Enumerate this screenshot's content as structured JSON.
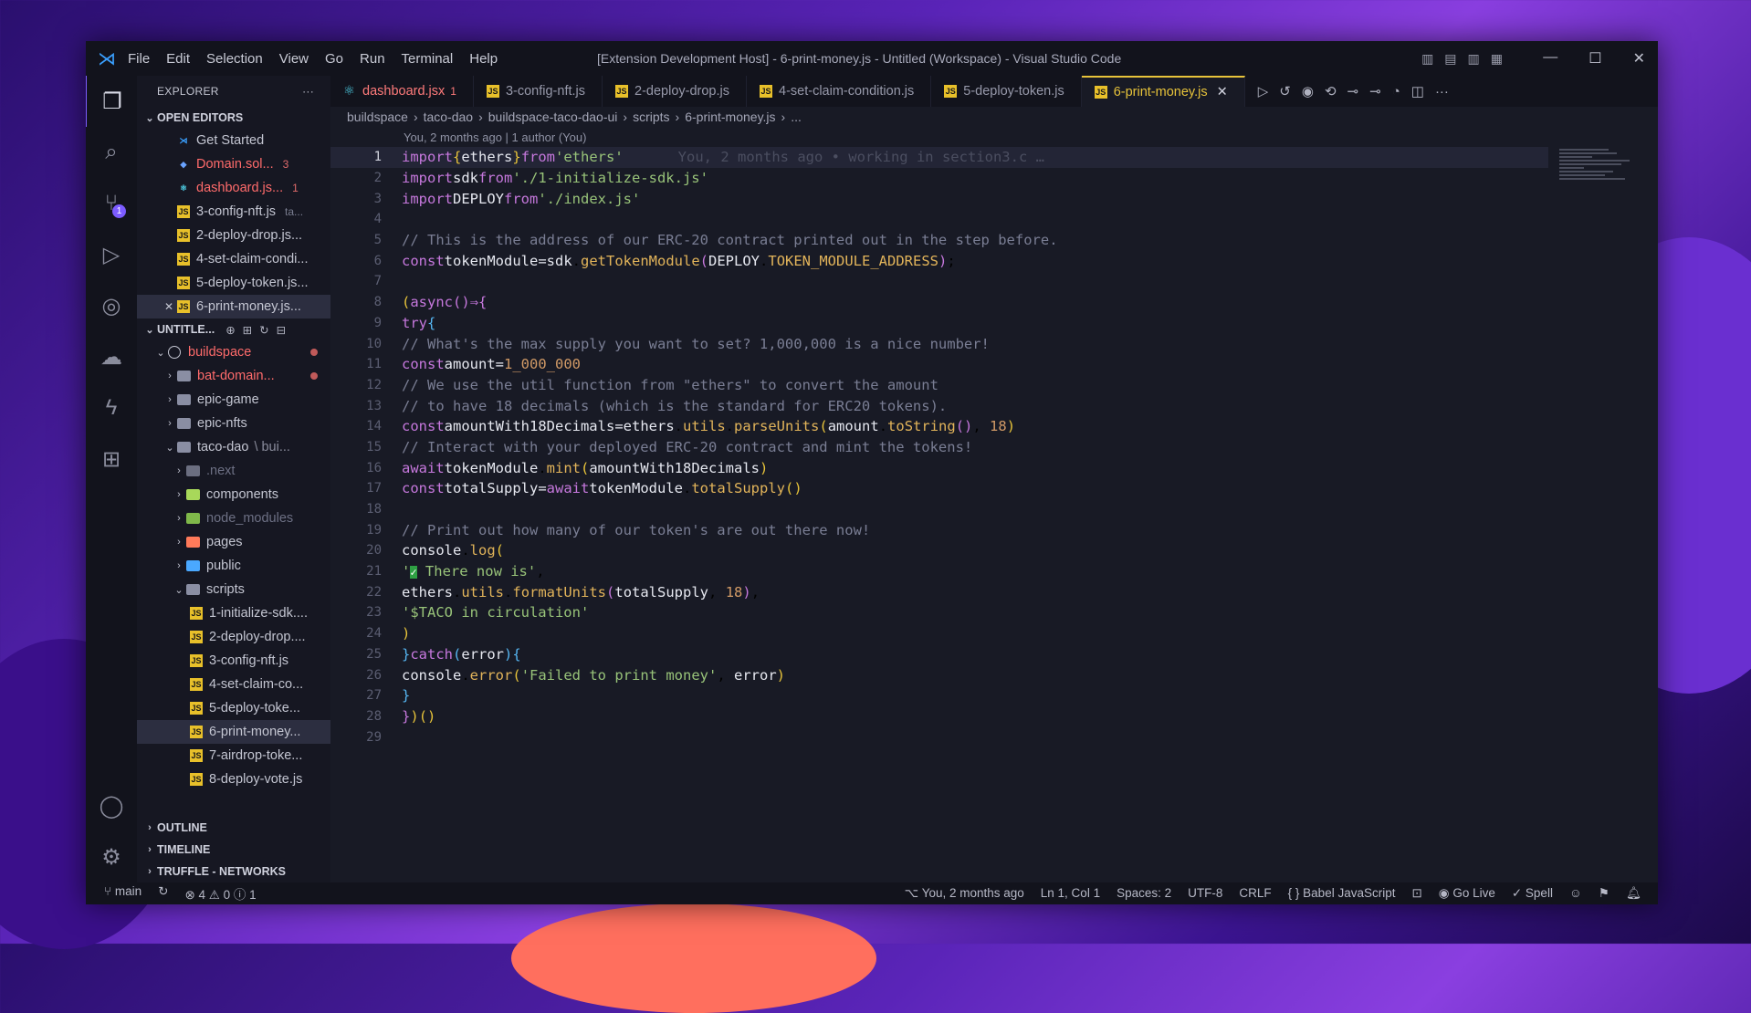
{
  "window_title": "[Extension Development Host] - 6-print-money.js - Untitled (Workspace) - Visual Studio Code",
  "menu": [
    "File",
    "Edit",
    "Selection",
    "View",
    "Go",
    "Run",
    "Terminal",
    "Help"
  ],
  "explorer": {
    "title": "EXPLORER",
    "open_editors_label": "OPEN EDITORS",
    "open_editors": [
      {
        "name": "Get Started",
        "extra": ""
      },
      {
        "name": "Domain.sol...",
        "extra": "3"
      },
      {
        "name": "dashboard.js...",
        "extra": "1"
      },
      {
        "name": "3-config-nft.js",
        "extra": "ta..."
      },
      {
        "name": "2-deploy-drop.js...",
        "extra": ""
      },
      {
        "name": "4-set-claim-condi...",
        "extra": ""
      },
      {
        "name": "5-deploy-token.js...",
        "extra": ""
      },
      {
        "name": "6-print-money.js...",
        "extra": ""
      }
    ],
    "workspace_label": "UNTITLE...",
    "tree": [
      {
        "name": "buildspace",
        "level": 1
      },
      {
        "name": "bat-domain...",
        "level": 2
      },
      {
        "name": "epic-game",
        "level": 2
      },
      {
        "name": "epic-nfts",
        "level": 2
      },
      {
        "name": "taco-dao",
        "extra": "\\ bui...",
        "level": 2
      },
      {
        "name": ".next",
        "level": 3
      },
      {
        "name": "components",
        "level": 3
      },
      {
        "name": "node_modules",
        "level": 3
      },
      {
        "name": "pages",
        "level": 3
      },
      {
        "name": "public",
        "level": 3
      },
      {
        "name": "scripts",
        "level": 3
      },
      {
        "name": "1-initialize-sdk....",
        "level": 4
      },
      {
        "name": "2-deploy-drop....",
        "level": 4
      },
      {
        "name": "3-config-nft.js",
        "level": 4
      },
      {
        "name": "4-set-claim-co...",
        "level": 4
      },
      {
        "name": "5-deploy-toke...",
        "level": 4
      },
      {
        "name": "6-print-money...",
        "level": 4
      },
      {
        "name": "7-airdrop-toke...",
        "level": 4
      },
      {
        "name": "8-deploy-vote.js",
        "level": 4
      }
    ],
    "outline_label": "OUTLINE",
    "timeline_label": "TIMELINE",
    "truffle_label": "TRUFFLE - NETWORKS"
  },
  "tabs": [
    {
      "label": "dashboard.jsx",
      "extra": "1"
    },
    {
      "label": "3-config-nft.js",
      "extra": ""
    },
    {
      "label": "2-deploy-drop.js",
      "extra": ""
    },
    {
      "label": "4-set-claim-condition.js",
      "extra": ""
    },
    {
      "label": "5-deploy-token.js",
      "extra": ""
    },
    {
      "label": "6-print-money.js",
      "extra": ""
    }
  ],
  "breadcrumb": [
    "buildspace",
    "taco-dao",
    "buildspace-taco-dao-ui",
    "scripts",
    "6-print-money.js",
    "..."
  ],
  "blame": "You, 2 months ago | 1 author (You)",
  "ghost_text": "You, 2 months ago • working in section3.c …",
  "line_numbers": [
    "1",
    "2",
    "3",
    "4",
    "5",
    "6",
    "7",
    "8",
    "9",
    "10",
    "11",
    "12",
    "13",
    "14",
    "15",
    "16",
    "17",
    "18",
    "19",
    "20",
    "21",
    "22",
    "23",
    "24",
    "25",
    "26",
    "27",
    "28",
    "29"
  ],
  "status": {
    "branch": "main",
    "errors": "4",
    "warnings": "0",
    "info": "1",
    "blame": "You, 2 months ago",
    "position": "Ln 1, Col 1",
    "spaces": "Spaces: 2",
    "encoding": "UTF-8",
    "eol": "CRLF",
    "language": "Babel JavaScript",
    "golive": "Go Live",
    "spell": "Spell"
  }
}
